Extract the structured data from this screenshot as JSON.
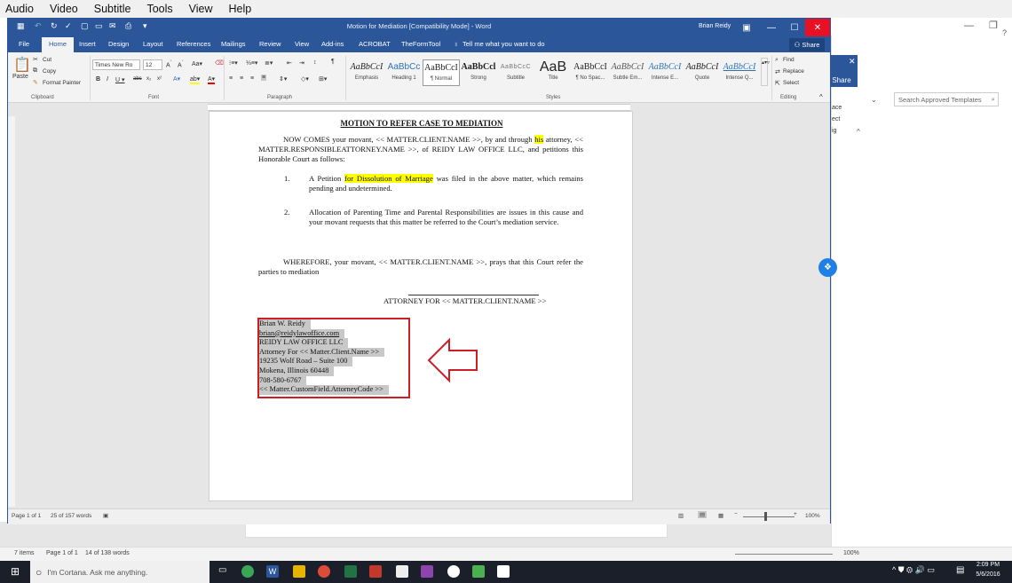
{
  "menubar": {
    "items": [
      "Audio",
      "Video",
      "Subtitle",
      "Tools",
      "View",
      "Help"
    ]
  },
  "window": {
    "title": "Motion for Mediation [Compatibility Mode] - Word",
    "user": "Brian Reidy",
    "tabs": [
      "File",
      "Home",
      "Insert",
      "Design",
      "Layout",
      "References",
      "Mailings",
      "Review",
      "View",
      "Add-ins",
      "ACROBAT",
      "TheFormTool"
    ],
    "tell_me": "Tell me what you want to do",
    "share": "Share"
  },
  "ribbon": {
    "clipboard": {
      "paste": "Paste",
      "cut": "Cut",
      "copy": "Copy",
      "format_painter": "Format Painter",
      "group": "Clipboard"
    },
    "font": {
      "name": "Times New Ro",
      "size": "12",
      "group": "Font"
    },
    "paragraph": {
      "group": "Paragraph"
    },
    "styles": {
      "group": "Styles",
      "items": [
        {
          "preview": "AaBbCcI",
          "name": "Emphasis"
        },
        {
          "preview": "AaBbCc",
          "name": "Heading 1"
        },
        {
          "preview": "AaBbCcI",
          "name": "¶ Normal"
        },
        {
          "preview": "AaBbCcl",
          "name": "Strong"
        },
        {
          "preview": "AaBbCcC",
          "name": "Subtitle"
        },
        {
          "preview": "AaB",
          "name": "Title"
        },
        {
          "preview": "AaBbCcI",
          "name": "¶ No Spac..."
        },
        {
          "preview": "AaBbCcI",
          "name": "Subtle Em..."
        },
        {
          "preview": "AaBbCcI",
          "name": "Intense E..."
        },
        {
          "preview": "AaBbCcI",
          "name": "Quote"
        },
        {
          "preview": "AaBbCcI",
          "name": "Intense Q..."
        }
      ]
    },
    "editing": {
      "find": "Find",
      "replace": "Replace",
      "select": "Select",
      "group": "Editing"
    }
  },
  "document": {
    "title": "MOTION TO REFER CASE TO MEDIATION",
    "intro_a": "NOW COMES your movant, << MATTER.CLIENT.NAME >>, by and through ",
    "intro_hl": "his",
    "intro_b": " attorney, << MATTER.RESPONSIBLEATTORNEY.NAME >>, of REIDY LAW OFFICE LLC, and petitions this Honorable Court as follows:",
    "item1_num": "1.",
    "item1_a": "A Petition ",
    "item1_hl": "for Dissolution of Marriage",
    "item1_b": " was filed in the above matter, which remains pending and undetermined.",
    "item2_num": "2.",
    "item2": "Allocation of Parenting Time and Parental Responsibilities are issues in this cause and your movant requests that this matter be referred to the Court’s mediation service.",
    "wherefore": "WHEREFORE, your movant, << MATTER.CLIENT.NAME >>, prays that this Court refer the parties to mediation",
    "attorney_for": "ATTORNEY FOR << MATTER.CLIENT.NAME >>",
    "signature": [
      "Brian W. Reidy",
      "brian@reidylawoffice.com",
      "REIDY LAW OFFICE LLC",
      "Attorney For << Matter.Client.Name >>",
      "19235 Wolf Road – Suite 100",
      "Mokena, Illinois 60448",
      "708-580-6767",
      "<< Matter.CustomField.AttorneyCode >>"
    ]
  },
  "status": {
    "page": "Page 1 of 1",
    "words": "25 of 157 words",
    "zoom": "100%"
  },
  "background": {
    "search_placeholder": "Search Approved Templates",
    "share": "Share",
    "items_count": "7 items",
    "page": "Page 1 of 1",
    "words": "14 of 138 words",
    "zoom": "100%",
    "side_labels": [
      "ace",
      "ect",
      "ig"
    ]
  },
  "taskbar": {
    "cortana": "I'm Cortana. Ask me anything.",
    "time": "2:09 PM",
    "date": "5/6/2016"
  },
  "colors": {
    "word_blue": "#2b579a",
    "highlight": "#ffff00",
    "callout_red": "#cc1f25",
    "close_red": "#e81123"
  }
}
